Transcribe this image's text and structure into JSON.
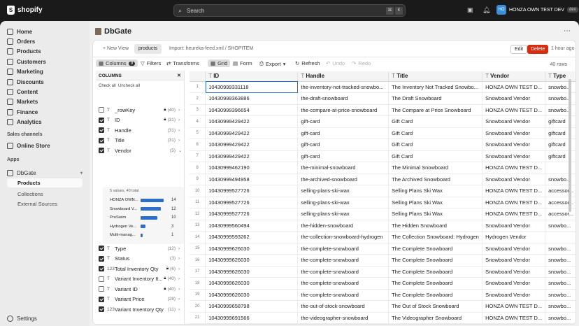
{
  "topbar": {
    "brand": "shopify",
    "search_placeholder": "Search",
    "kbd1": "⌘",
    "kbd2": "K",
    "store_initials": "HO",
    "store_name": "HONZA OWN TEST DEV",
    "store_badge": "dev"
  },
  "sidebar": {
    "items": [
      {
        "label": "Home",
        "icon": "home-icon"
      },
      {
        "label": "Orders",
        "icon": "orders-icon"
      },
      {
        "label": "Products",
        "icon": "products-icon"
      },
      {
        "label": "Customers",
        "icon": "customers-icon"
      },
      {
        "label": "Marketing",
        "icon": "marketing-icon"
      },
      {
        "label": "Discounts",
        "icon": "discounts-icon"
      },
      {
        "label": "Content",
        "icon": "content-icon"
      },
      {
        "label": "Markets",
        "icon": "markets-icon"
      },
      {
        "label": "Finance",
        "icon": "finance-icon"
      },
      {
        "label": "Analytics",
        "icon": "analytics-icon"
      }
    ],
    "sales_channels_label": "Sales channels",
    "online_store": "Online Store",
    "apps_label": "Apps",
    "dbgate": "DbGate",
    "sub_products": "Products",
    "sub_collections": "Collections",
    "sub_external": "External Sources",
    "settings": "Settings"
  },
  "app": {
    "title": "DbGate",
    "new_view": "+ New View",
    "tab_products": "products",
    "tab_import": "Import: heureka-feed.xml / SHOPITEM",
    "edit": "Edit",
    "delete": "Delete",
    "ago": "1 hour ago"
  },
  "toolbar": {
    "columns": "Columns",
    "columns_count": "9",
    "filters": "Filters",
    "transforms": "Transforms",
    "grid": "Grid",
    "form": "Form",
    "export": "Export",
    "refresh": "Refresh",
    "undo": "Undo",
    "redo": "Redo",
    "rows": "40 rows"
  },
  "colpanel": {
    "title": "COLUMNS",
    "check_all": "Check all",
    "uncheck_all": "Uncheck all",
    "columns_top": [
      {
        "name": "_rowKey",
        "type": "T",
        "count": "(40)",
        "checked": false,
        "lock": true
      },
      {
        "name": "ID",
        "type": "T",
        "count": "(31)",
        "checked": true,
        "lock": true
      },
      {
        "name": "Handle",
        "type": "T",
        "count": "(31)",
        "checked": true,
        "lock": false
      },
      {
        "name": "Title",
        "type": "T",
        "count": "(31)",
        "checked": true,
        "lock": false
      },
      {
        "name": "Vendor",
        "type": "T",
        "count": "(5)",
        "checked": true,
        "lock": false,
        "expanded": true
      }
    ],
    "vendor_summary": "5 values, 40 total",
    "vendor_values": [
      {
        "label": "HONZA OWN...",
        "count": 14,
        "frac": 0.93
      },
      {
        "label": "Snowboard V...",
        "count": 12,
        "frac": 0.8
      },
      {
        "label": "ProSwim",
        "count": 10,
        "frac": 0.67
      },
      {
        "label": "Hydrogen Ve...",
        "count": 3,
        "frac": 0.2
      },
      {
        "label": "Multi-manag...",
        "count": 1,
        "frac": 0.07
      }
    ],
    "columns_bottom": [
      {
        "name": "Type",
        "type": "T",
        "count": "(12)",
        "checked": true,
        "lock": false
      },
      {
        "name": "Status",
        "type": "T",
        "count": "(3)",
        "checked": true,
        "lock": false
      },
      {
        "name": "Total Inventory Qty",
        "type": "123",
        "count": "(6)",
        "checked": true,
        "lock": true
      },
      {
        "name": "Variant Inventory It...",
        "type": "T",
        "count": "(40)",
        "checked": false,
        "lock": true
      },
      {
        "name": "Variant ID",
        "type": "T",
        "count": "(40)",
        "checked": false,
        "lock": true
      },
      {
        "name": "Variant Price",
        "type": "T",
        "count": "(28)",
        "checked": true,
        "lock": false
      },
      {
        "name": "Variant Inventory Qty",
        "type": "123",
        "count": "(11)",
        "checked": true,
        "lock": false
      }
    ]
  },
  "grid": {
    "headers": [
      "ID",
      "Handle",
      "Title",
      "Vendor",
      "Type"
    ],
    "rows": [
      [
        "1",
        "10430999331118",
        "the-inventory-not-tracked-snowbo...",
        "The Inventory Not Tracked Snowbo...",
        "HONZA OWN TEST D...",
        "snowbo..."
      ],
      [
        "2",
        "10430999363886",
        "the-draft-snowboard",
        "The Draft Snowboard",
        "Snowboard Vendor",
        "snowbo..."
      ],
      [
        "3",
        "10430999396654",
        "the-compare-at-price-snowboard",
        "The Compare at Price Snowboard",
        "HONZA OWN TEST D...",
        "snowbo..."
      ],
      [
        "4",
        "10430999429422",
        "gift-card",
        "Gift Card",
        "Snowboard Vendor",
        "giftcard"
      ],
      [
        "5",
        "10430999429422",
        "gift-card",
        "Gift Card",
        "Snowboard Vendor",
        "giftcard"
      ],
      [
        "6",
        "10430999429422",
        "gift-card",
        "Gift Card",
        "Snowboard Vendor",
        "giftcard"
      ],
      [
        "7",
        "10430999429422",
        "gift-card",
        "Gift Card",
        "Snowboard Vendor",
        "giftcard"
      ],
      [
        "8",
        "10430999462190",
        "the-minimal-snowboard",
        "The Minimal Snowboard",
        "HONZA OWN TEST D...",
        ""
      ],
      [
        "9",
        "10430999494958",
        "the-archived-snowboard",
        "The Archived Snowboard",
        "Snowboard Vendor",
        "snowbo..."
      ],
      [
        "10",
        "10430999527726",
        "selling-plans-ski-wax",
        "Selling Plans Ski Wax",
        "HONZA OWN TEST D...",
        "accessor..."
      ],
      [
        "11",
        "10430999527726",
        "selling-plans-ski-wax",
        "Selling Plans Ski Wax",
        "HONZA OWN TEST D...",
        "accessor..."
      ],
      [
        "12",
        "10430999527726",
        "selling-plans-ski-wax",
        "Selling Plans Ski Wax",
        "HONZA OWN TEST D...",
        "accessor..."
      ],
      [
        "13",
        "10430999560494",
        "the-hidden-snowboard",
        "The Hidden Snowboard",
        "Snowboard Vendor",
        "snowbo..."
      ],
      [
        "14",
        "10430999593262",
        "the-collection-snowboard-hydrogen",
        "The Collection Snowboard: Hydrogen",
        "Hydrogen Vendor",
        ""
      ],
      [
        "15",
        "10430999626030",
        "the-complete-snowboard",
        "The Complete Snowboard",
        "Snowboard Vendor",
        "snowbo..."
      ],
      [
        "16",
        "10430999626030",
        "the-complete-snowboard",
        "The Complete Snowboard",
        "Snowboard Vendor",
        "snowbo..."
      ],
      [
        "17",
        "10430999626030",
        "the-complete-snowboard",
        "The Complete Snowboard",
        "Snowboard Vendor",
        "snowbo..."
      ],
      [
        "18",
        "10430999626030",
        "the-complete-snowboard",
        "The Complete Snowboard",
        "Snowboard Vendor",
        "snowbo..."
      ],
      [
        "19",
        "10430999626030",
        "the-complete-snowboard",
        "The Complete Snowboard",
        "Snowboard Vendor",
        "snowbo..."
      ],
      [
        "20",
        "10430999658798",
        "the-out-of-stock-snowboard",
        "The Out of Stock Snowboard",
        "HONZA OWN TEST D...",
        "snowbo..."
      ],
      [
        "21",
        "10430999691566",
        "the-videographer-snowboard",
        "The Videographer Snowboard",
        "HONZA OWN TEST D...",
        "snowbo..."
      ]
    ]
  },
  "colors": {
    "accent": "#2c6ecb",
    "danger": "#d72c0d",
    "topbar": "#1a1a1a"
  }
}
